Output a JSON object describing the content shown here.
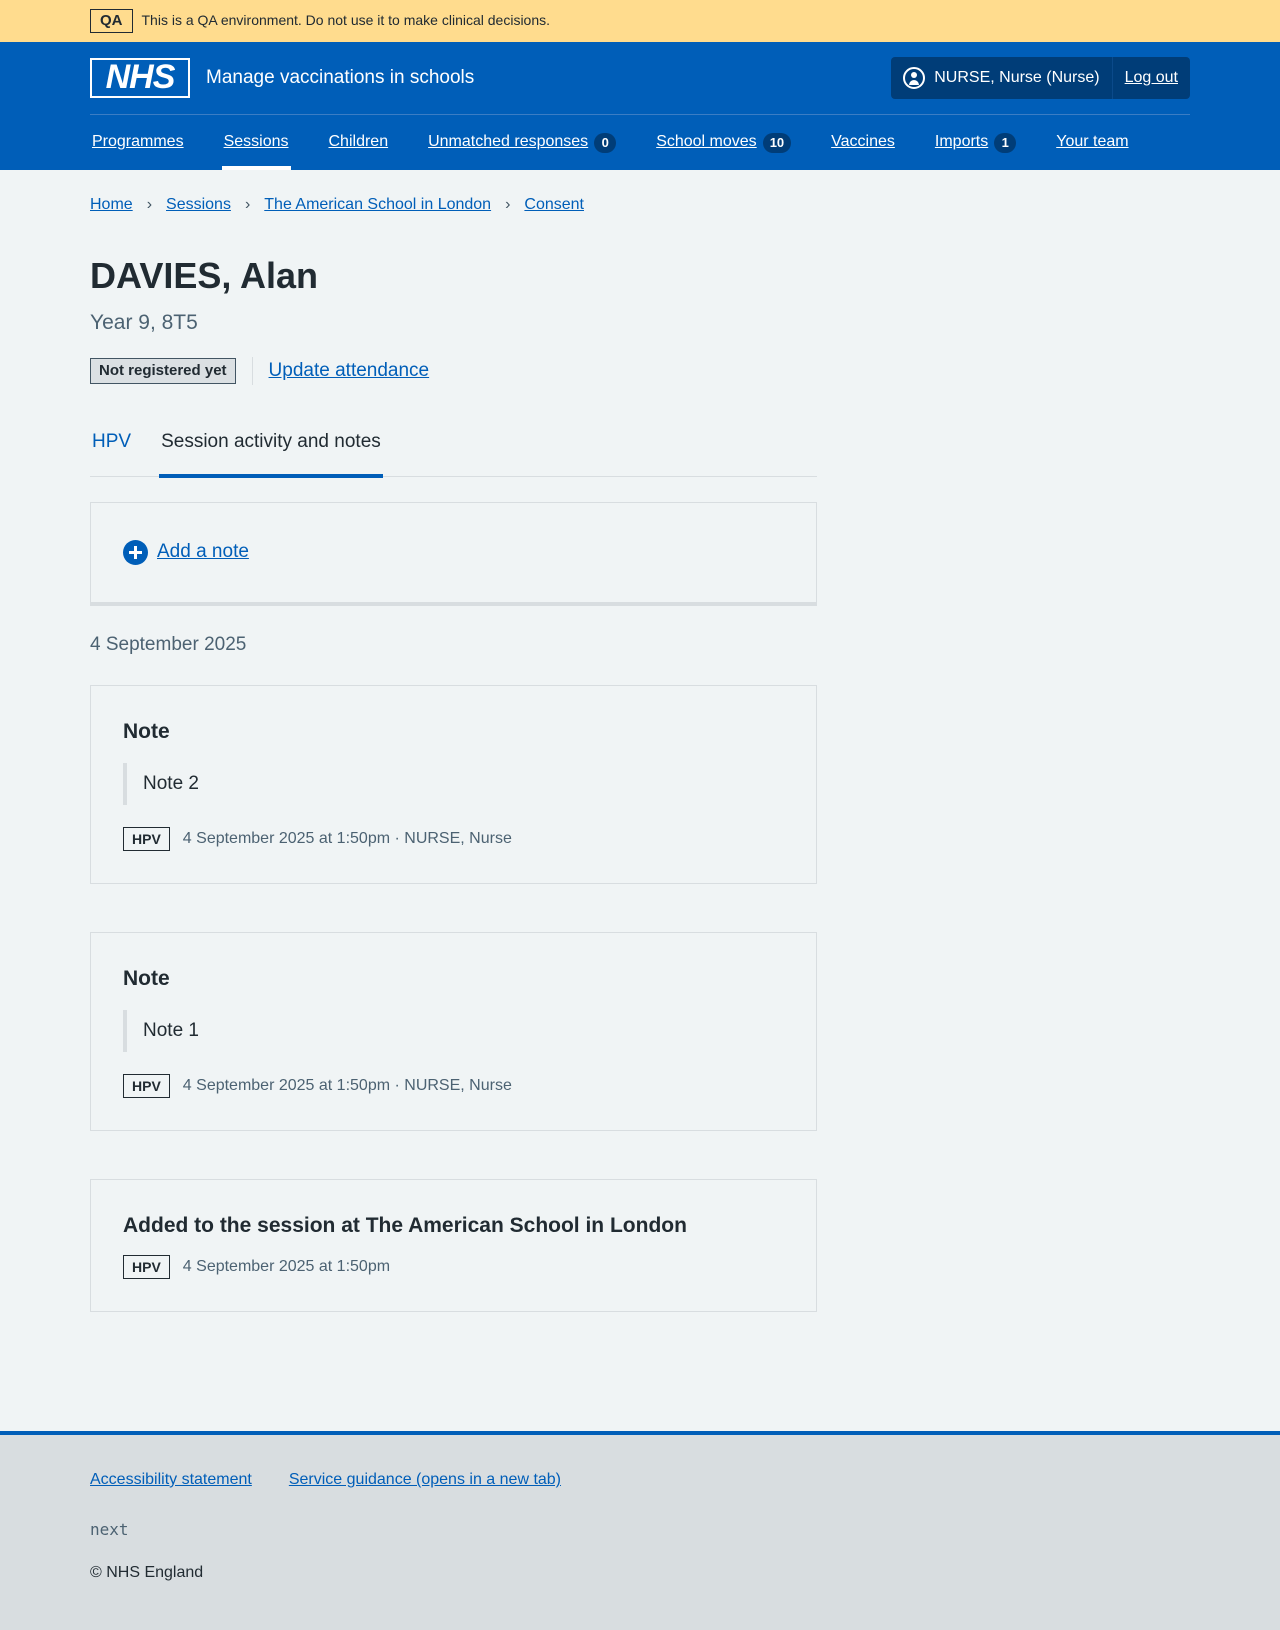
{
  "qa_banner": {
    "tag": "QA",
    "text": "This is a QA environment. Do not use it to make clinical decisions."
  },
  "header": {
    "logo_text": "NHS",
    "service_name": "Manage vaccinations in schools",
    "user_name": "NURSE, Nurse (Nurse)",
    "logout_label": "Log out"
  },
  "nav": {
    "items": [
      {
        "label": "Programmes",
        "count": null
      },
      {
        "label": "Sessions",
        "count": null,
        "active": true
      },
      {
        "label": "Children",
        "count": null
      },
      {
        "label": "Unmatched responses",
        "count": "0"
      },
      {
        "label": "School moves",
        "count": "10"
      },
      {
        "label": "Vaccines",
        "count": null
      },
      {
        "label": "Imports",
        "count": "1"
      },
      {
        "label": "Your team",
        "count": null
      }
    ]
  },
  "breadcrumb": [
    "Home",
    "Sessions",
    "The American School in London",
    "Consent"
  ],
  "patient": {
    "name": "DAVIES, Alan",
    "caption": "Year 9, 8T5",
    "status": "Not registered yet",
    "attendance_link": "Update attendance"
  },
  "tabs": [
    "HPV",
    "Session activity and notes"
  ],
  "add_note_label": "Add a note",
  "date_heading": "4 September 2025",
  "cards": [
    {
      "title": "Note",
      "note": "Note 2",
      "tag": "HPV",
      "meta": "4 September 2025 at 1:50pm · NURSE, Nurse"
    },
    {
      "title": "Note",
      "note": "Note 1",
      "tag": "HPV",
      "meta": "4 September 2025 at 1:50pm · NURSE, Nurse"
    },
    {
      "title": "Added to the session at The American School in London",
      "tag": "HPV",
      "meta": "4 September 2025 at 1:50pm"
    }
  ],
  "footer": {
    "links": [
      "Accessibility statement",
      "Service guidance (opens in a new tab)"
    ],
    "version": "next",
    "copyright": "© NHS England"
  }
}
